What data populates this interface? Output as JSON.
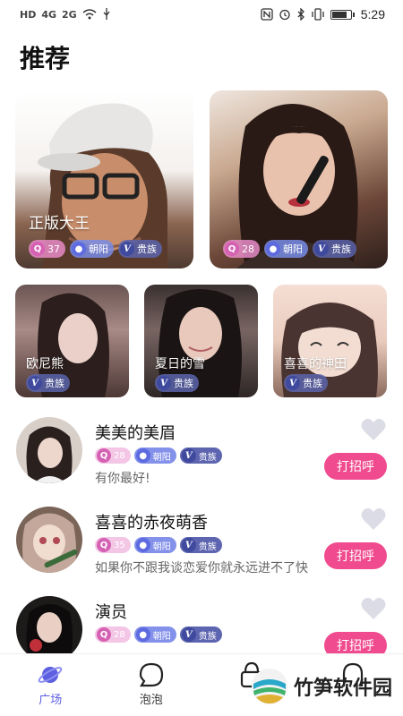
{
  "status_bar": {
    "left_icons": [
      "HD",
      "4G",
      "2G"
    ],
    "time": "5:29",
    "battery_level": 0.85
  },
  "page": {
    "title": "推荐"
  },
  "featured": [
    {
      "name": "正版大王",
      "age": "37",
      "location": "朝阳",
      "rank": "贵族"
    },
    {
      "name": "",
      "age": "28",
      "location": "朝阳",
      "rank": "贵族"
    }
  ],
  "small_cards": [
    {
      "name": "欧尼熊",
      "rank": "贵族"
    },
    {
      "name": "夏日的雪",
      "rank": "贵族"
    },
    {
      "name": "喜喜的神田",
      "rank": "贵族"
    }
  ],
  "list": [
    {
      "name": "美美的美眉",
      "age": "28",
      "location": "朝阳",
      "rank": "贵族",
      "message": "有你最好!",
      "button": "打招呼"
    },
    {
      "name": "喜喜的赤夜萌香",
      "age": "35",
      "location": "朝阳",
      "rank": "贵族",
      "message": "如果你不跟我谈恋爱你就永远进不了快",
      "button": "打招呼"
    },
    {
      "name": "演员",
      "age": "28",
      "location": "朝阳",
      "rank": "贵族",
      "message": "",
      "button": "打招呼"
    }
  ],
  "tag_icons": {
    "age": "Q",
    "location": "●",
    "rank": "V"
  },
  "bottom_nav": [
    {
      "label": "广场",
      "icon": "planet-icon",
      "active": true
    },
    {
      "label": "泡泡",
      "icon": "bubble-icon",
      "active": false
    },
    {
      "label": "",
      "icon": "bag-icon",
      "active": false
    },
    {
      "label": "",
      "icon": "profile-icon",
      "active": false
    }
  ],
  "watermark": {
    "text": "竹笋软件园"
  },
  "colors": {
    "accent": "#5b5fe0",
    "button": "#f04b8e"
  }
}
